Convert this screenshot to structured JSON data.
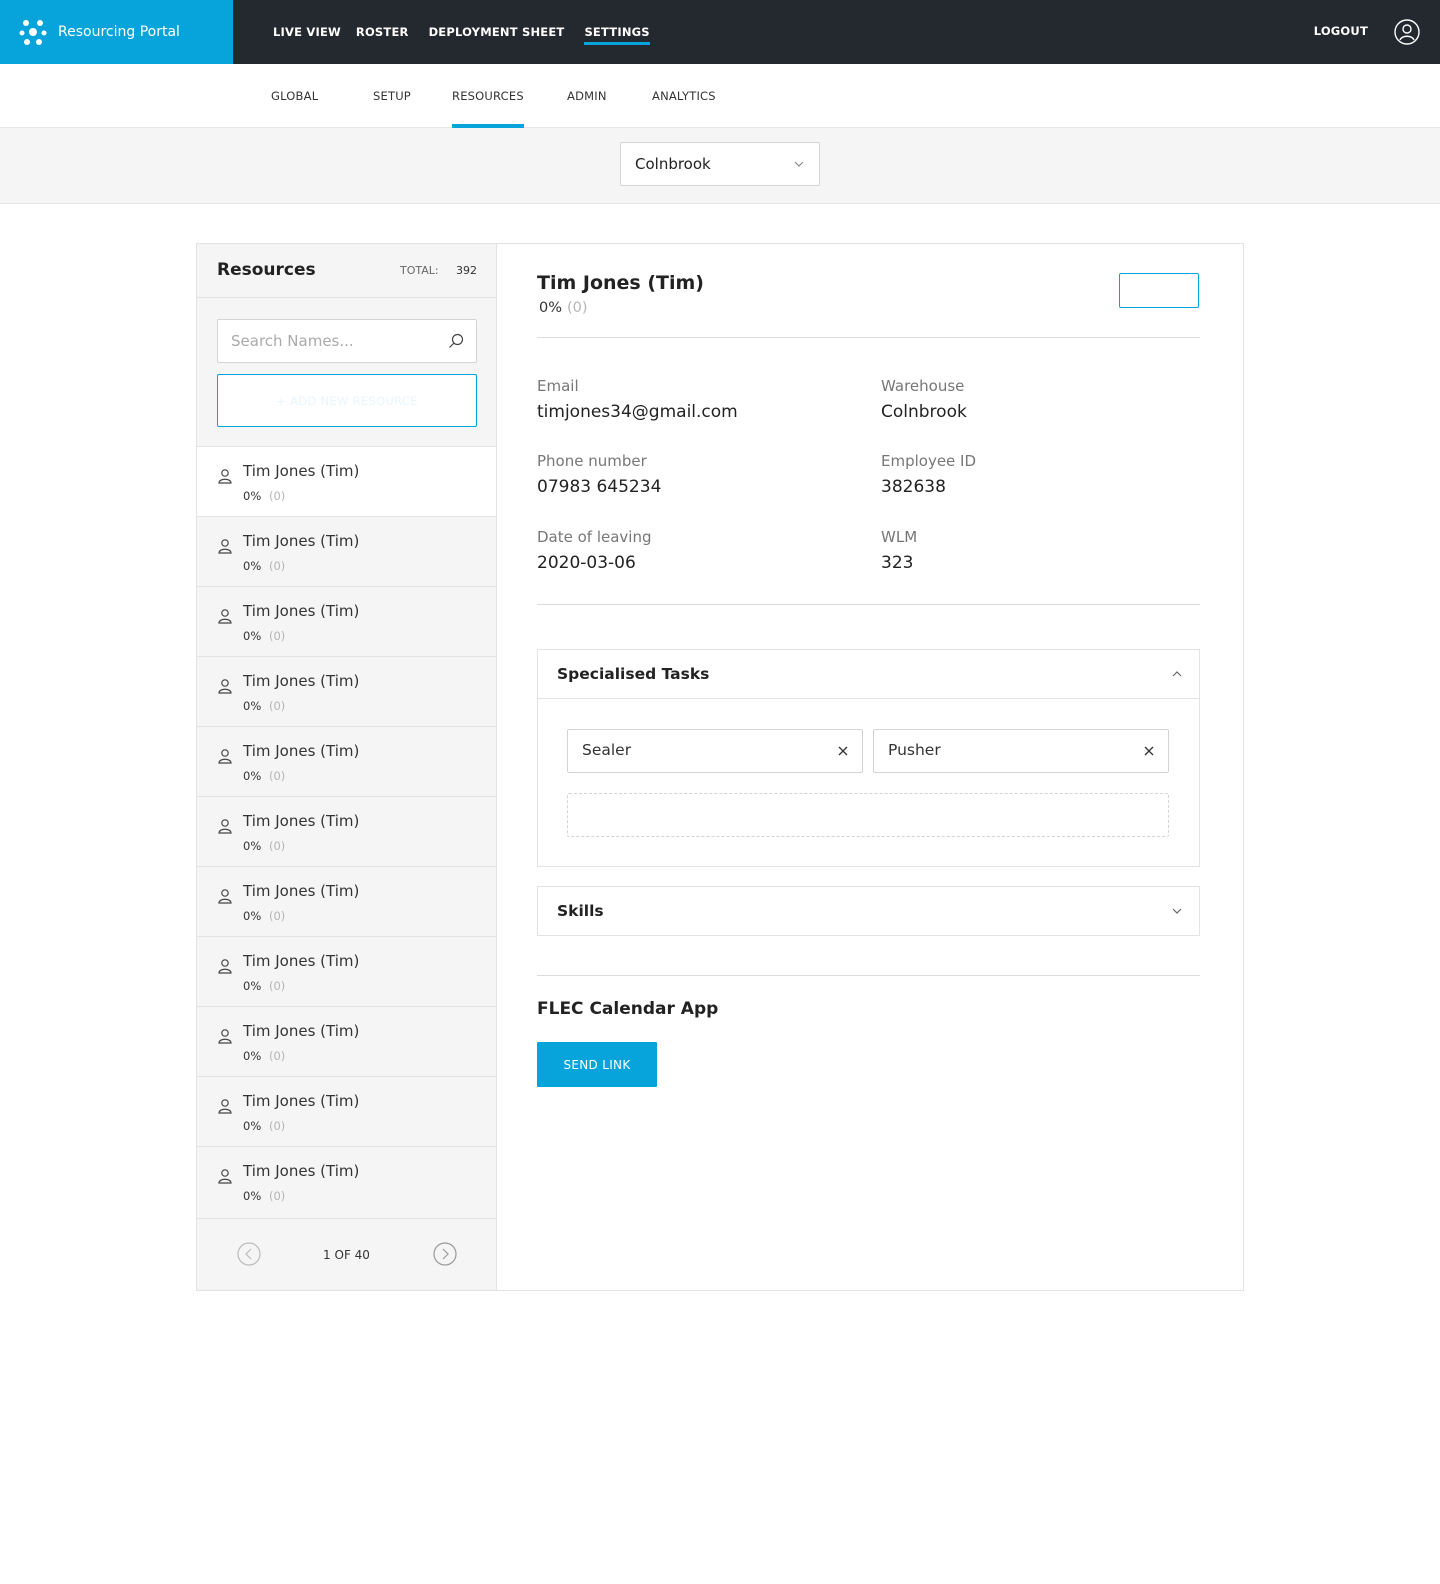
{
  "app": {
    "name": "Resourcing Portal"
  },
  "topnav": [
    {
      "label": "LIVE VIEW"
    },
    {
      "label": "ROSTER"
    },
    {
      "label": "DEPLOYMENT SHEET"
    },
    {
      "label": "SETTINGS"
    }
  ],
  "logout_label": "LOGOUT",
  "subnav": [
    {
      "label": "GLOBAL"
    },
    {
      "label": "SETUP"
    },
    {
      "label": "RESOURCES"
    },
    {
      "label": "ADMIN"
    },
    {
      "label": "ANALYTICS"
    }
  ],
  "warehouse_select": {
    "value": "Colnbrook"
  },
  "resources": {
    "title": "Resources",
    "total_label": "TOTAL:",
    "total_value": "392",
    "search_placeholder": "Search Names...",
    "add_label": "+ ADD NEW RESOURCE",
    "items": [
      {
        "name": "Tim Jones (Tim)",
        "pct": "0%",
        "count": "(0)"
      },
      {
        "name": "Tim Jones (Tim)",
        "pct": "0%",
        "count": "(0)"
      },
      {
        "name": "Tim Jones (Tim)",
        "pct": "0%",
        "count": "(0)"
      },
      {
        "name": "Tim Jones (Tim)",
        "pct": "0%",
        "count": "(0)"
      },
      {
        "name": "Tim Jones (Tim)",
        "pct": "0%",
        "count": "(0)"
      },
      {
        "name": "Tim Jones (Tim)",
        "pct": "0%",
        "count": "(0)"
      },
      {
        "name": "Tim Jones (Tim)",
        "pct": "0%",
        "count": "(0)"
      },
      {
        "name": "Tim Jones (Tim)",
        "pct": "0%",
        "count": "(0)"
      },
      {
        "name": "Tim Jones (Tim)",
        "pct": "0%",
        "count": "(0)"
      },
      {
        "name": "Tim Jones (Tim)",
        "pct": "0%",
        "count": "(0)"
      },
      {
        "name": "Tim Jones (Tim)",
        "pct": "0%",
        "count": "(0)"
      }
    ],
    "pager_text": "1 OF 40"
  },
  "detail": {
    "name": "Tim Jones (Tim)",
    "pct": "0%",
    "count": "(0)",
    "fields": {
      "email_label": "Email",
      "email_value": "timjones34@gmail.com",
      "warehouse_label": "Warehouse",
      "warehouse_value": "Colnbrook",
      "phone_label": "Phone number",
      "phone_value": "07983 645234",
      "employee_label": "Employee ID",
      "employee_value": "382638",
      "leaving_label": "Date of leaving",
      "leaving_value": "2020-03-06",
      "wlm_label": "WLM",
      "wlm_value": "323"
    },
    "specialised_title": "Specialised Tasks",
    "tags": [
      "Sealer",
      "Pusher"
    ],
    "skills_title": "Skills",
    "flec_title": "FLEC Calendar App",
    "send_label": "SEND LINK"
  },
  "colors": {
    "accent": "#06a4db",
    "topbar": "#24282f"
  }
}
